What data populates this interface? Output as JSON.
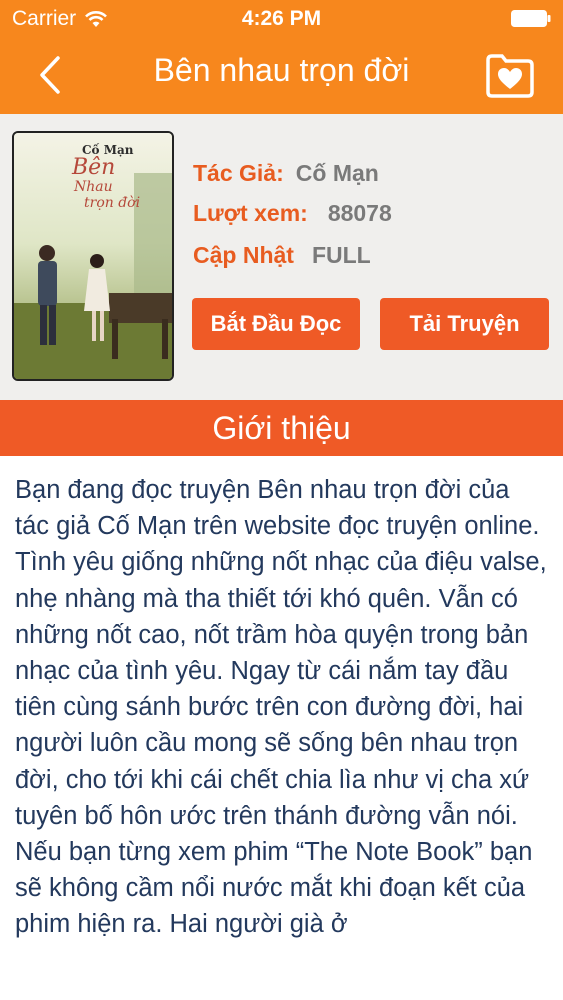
{
  "status_bar": {
    "carrier": "Carrier",
    "time": "4:26 PM"
  },
  "nav": {
    "title": "Bên nhau trọn đời",
    "back_icon": "chevron-left-icon",
    "favorite_icon": "folder-heart-icon"
  },
  "book": {
    "cover_title_line1": "Cố Mạn",
    "cover_title_line2": "Bên",
    "cover_title_line3": "Nhau",
    "cover_title_line4": "trọn đời",
    "author_label": "Tác Giả:",
    "author_value": "Cố Mạn",
    "views_label": "Lượt xem:",
    "views_value": "88078",
    "update_label": "Cập Nhật",
    "update_value": "FULL",
    "read_button": "Bắt Đầu Đọc",
    "download_button": "Tải Truyện"
  },
  "intro": {
    "heading": "Giới thiệu",
    "text": "Bạn đang đọc truyện Bên nhau trọn đời của tác giả Cố Mạn trên website đọc truyện online. Tình yêu giống những nốt nhạc của điệu valse, nhẹ nhàng mà tha thiết tới khó quên. Vẫn có những nốt cao, nốt trầm hòa quyện trong bản nhạc của tình yêu. Ngay từ cái nắm tay đầu tiên cùng sánh bước trên con đường đời, hai người luôn cầu mong sẽ sống bên nhau trọn đời, cho tới khi cái chết chia lìa như vị cha xứ tuyên bố hôn ước trên thánh đường vẫn nói. Nếu bạn từng xem phim “The Note Book” bạn sẽ không cầm nổi nước mắt khi đoạn kết của phim hiện ra. Hai người già ở"
  },
  "colors": {
    "header": "#f7871d",
    "accent": "#ef5a26",
    "label": "#e85c20",
    "body_text": "#23395d"
  }
}
